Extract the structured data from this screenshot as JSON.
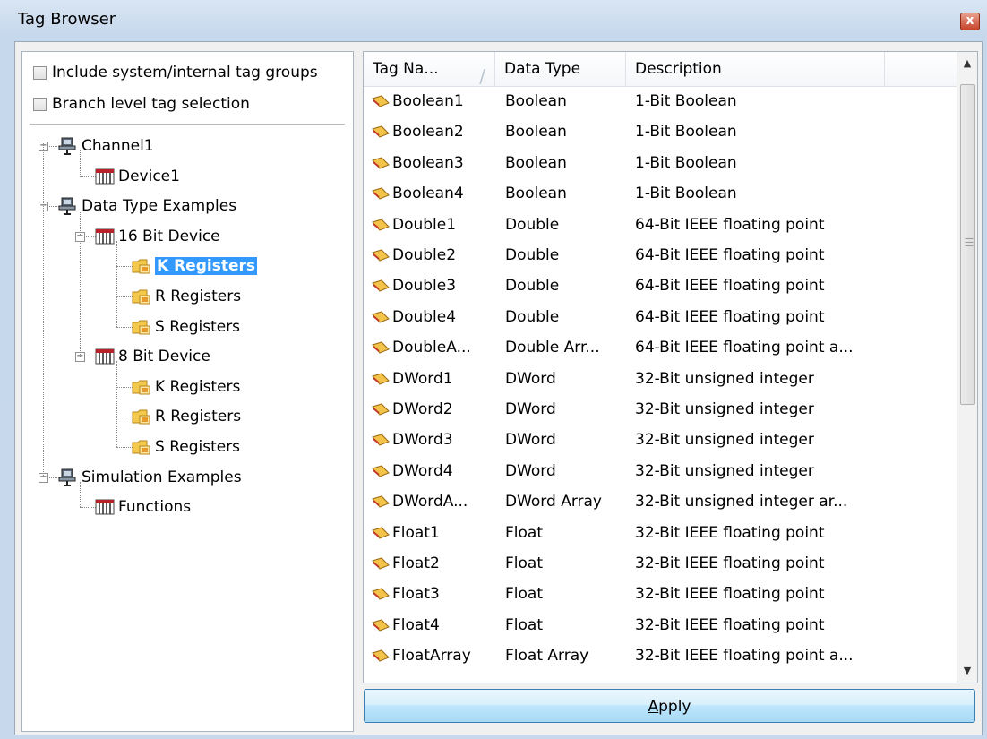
{
  "window": {
    "title": "Tag Browser",
    "close_glyph": "x"
  },
  "options": {
    "include_system": {
      "label": "Include system/internal tag groups",
      "checked": false
    },
    "branch_level": {
      "label": "Branch level tag selection",
      "checked": false
    }
  },
  "tree": {
    "nodes": [
      {
        "label": "Channel1",
        "icon": "channel-icon"
      },
      {
        "label": "Device1",
        "icon": "device-icon"
      },
      {
        "label": "Data Type Examples",
        "icon": "channel-icon"
      },
      {
        "label": "16 Bit Device",
        "icon": "device-icon"
      },
      {
        "label": "K Registers",
        "icon": "tag-group-icon",
        "selected": true
      },
      {
        "label": "R Registers",
        "icon": "tag-group-icon"
      },
      {
        "label": "S Registers",
        "icon": "tag-group-icon"
      },
      {
        "label": "8 Bit Device",
        "icon": "device-icon"
      },
      {
        "label": "K Registers",
        "icon": "tag-group-icon"
      },
      {
        "label": "R Registers",
        "icon": "tag-group-icon"
      },
      {
        "label": "S Registers",
        "icon": "tag-group-icon"
      },
      {
        "label": "Simulation Examples",
        "icon": "channel-icon"
      },
      {
        "label": "Functions",
        "icon": "device-icon"
      }
    ]
  },
  "table": {
    "columns": [
      "Tag Na...",
      "Data Type",
      "Description"
    ],
    "sort_glyph": "/",
    "rows": [
      {
        "name": "Boolean1",
        "type": "Boolean",
        "desc": "1-Bit Boolean"
      },
      {
        "name": "Boolean2",
        "type": "Boolean",
        "desc": "1-Bit Boolean"
      },
      {
        "name": "Boolean3",
        "type": "Boolean",
        "desc": "1-Bit Boolean"
      },
      {
        "name": "Boolean4",
        "type": "Boolean",
        "desc": "1-Bit Boolean"
      },
      {
        "name": "Double1",
        "type": "Double",
        "desc": "64-Bit IEEE floating point"
      },
      {
        "name": "Double2",
        "type": "Double",
        "desc": "64-Bit IEEE floating point"
      },
      {
        "name": "Double3",
        "type": "Double",
        "desc": "64-Bit IEEE floating point"
      },
      {
        "name": "Double4",
        "type": "Double",
        "desc": "64-Bit IEEE floating point"
      },
      {
        "name": "DoubleA...",
        "type": "Double Arr...",
        "desc": "64-Bit IEEE floating point a..."
      },
      {
        "name": "DWord1",
        "type": "DWord",
        "desc": "32-Bit unsigned integer"
      },
      {
        "name": "DWord2",
        "type": "DWord",
        "desc": "32-Bit unsigned integer"
      },
      {
        "name": "DWord3",
        "type": "DWord",
        "desc": "32-Bit unsigned integer"
      },
      {
        "name": "DWord4",
        "type": "DWord",
        "desc": "32-Bit unsigned integer"
      },
      {
        "name": "DWordA...",
        "type": "DWord Array",
        "desc": "32-Bit unsigned integer ar..."
      },
      {
        "name": "Float1",
        "type": "Float",
        "desc": "32-Bit IEEE floating point"
      },
      {
        "name": "Float2",
        "type": "Float",
        "desc": "32-Bit IEEE floating point"
      },
      {
        "name": "Float3",
        "type": "Float",
        "desc": "32-Bit IEEE floating point"
      },
      {
        "name": "Float4",
        "type": "Float",
        "desc": "32-Bit IEEE floating point"
      },
      {
        "name": "FloatArray",
        "type": "Float Array",
        "desc": "32-Bit IEEE floating point a..."
      }
    ]
  },
  "apply_button": {
    "label": "Apply"
  },
  "colors": {
    "selection": "#3399ff",
    "close": "#c7432a",
    "button_border": "#3c7fb1"
  }
}
